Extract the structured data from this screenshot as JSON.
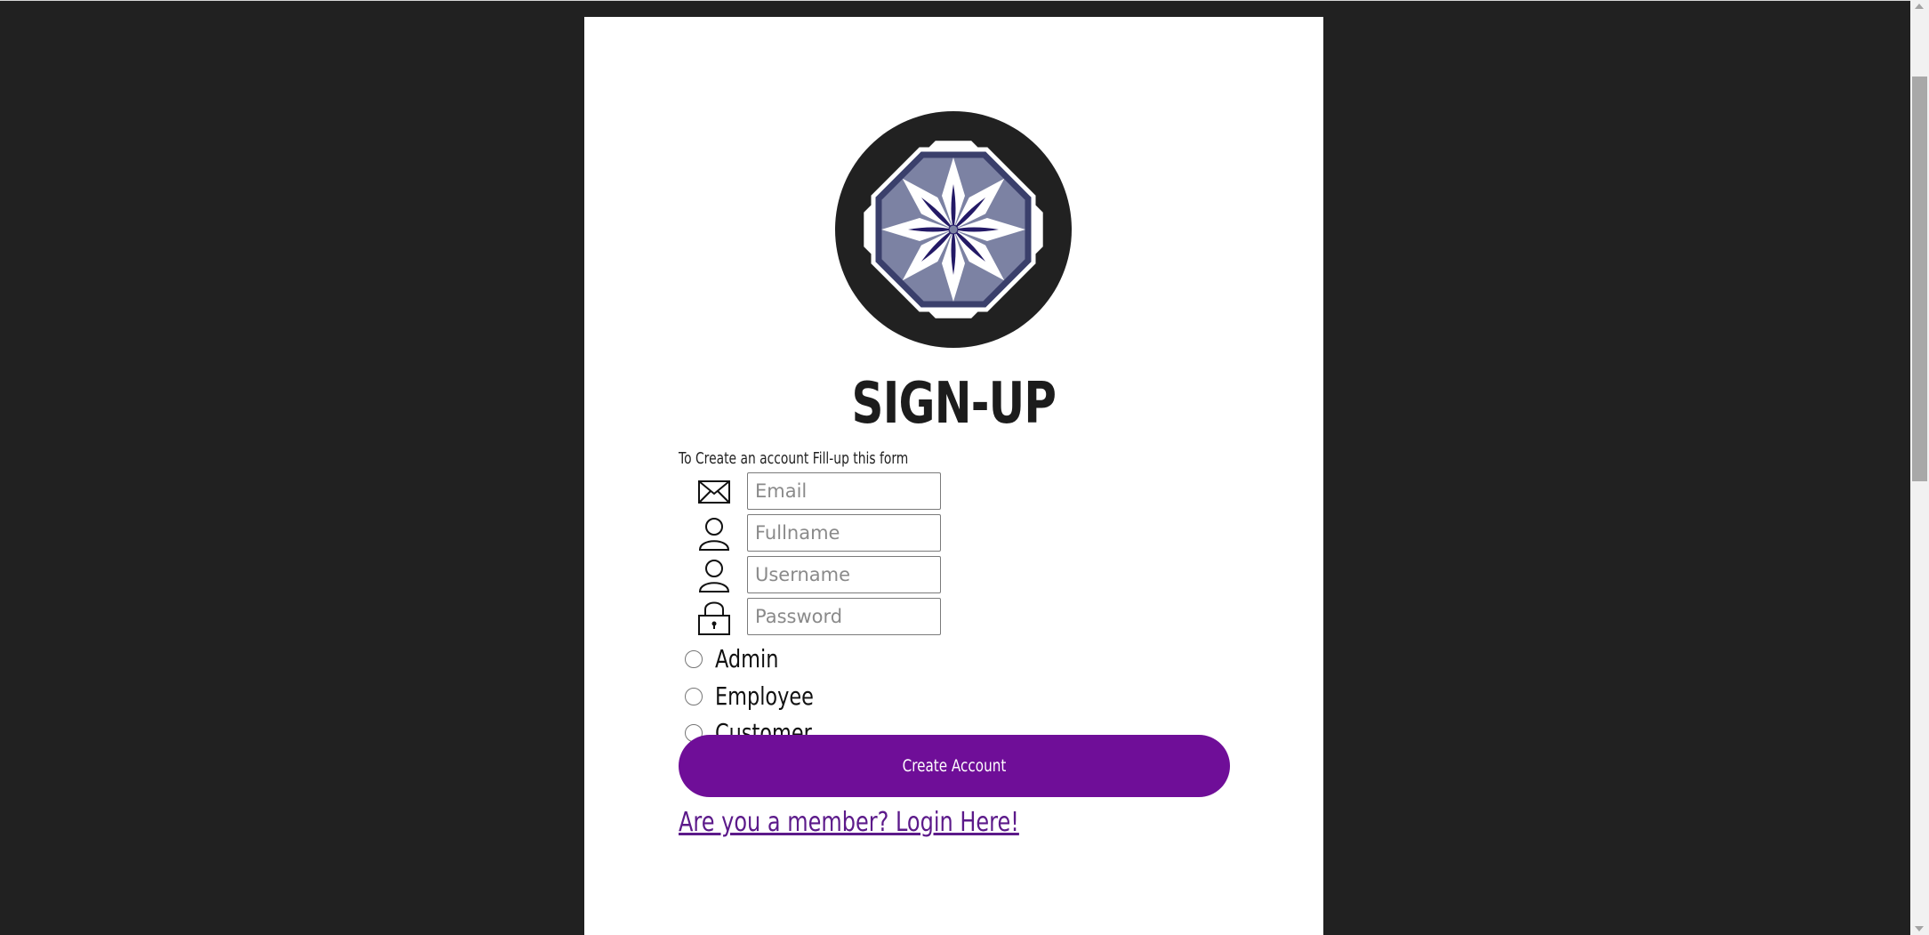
{
  "form": {
    "title": "SIGN-UP",
    "instructions": "To Create an account Fill-up this form",
    "fields": [
      {
        "name": "email",
        "placeholder": "Email",
        "value": "",
        "icon": "envelope-icon"
      },
      {
        "name": "fullname",
        "placeholder": "Fullname",
        "value": "",
        "icon": "user-icon"
      },
      {
        "name": "username",
        "placeholder": "Username",
        "value": "",
        "icon": "user-icon"
      },
      {
        "name": "password",
        "placeholder": "Password",
        "value": "",
        "icon": "lock-icon"
      }
    ],
    "roles": [
      {
        "label": "Admin",
        "selected": false
      },
      {
        "label": "Employee",
        "selected": false
      },
      {
        "label": "Customer",
        "selected": false
      }
    ],
    "submit_label": "Create Account",
    "login_link": "Are you a member? Login Here!"
  },
  "colors": {
    "page_background": "#212121",
    "card_background": "#ffffff",
    "button": "#6f0e98",
    "link": "#5c1a8a",
    "logo_dark": "#212121",
    "logo_navy": "#3a3f6b",
    "logo_slate": "#7c82a3",
    "logo_flower": "#241a66"
  }
}
